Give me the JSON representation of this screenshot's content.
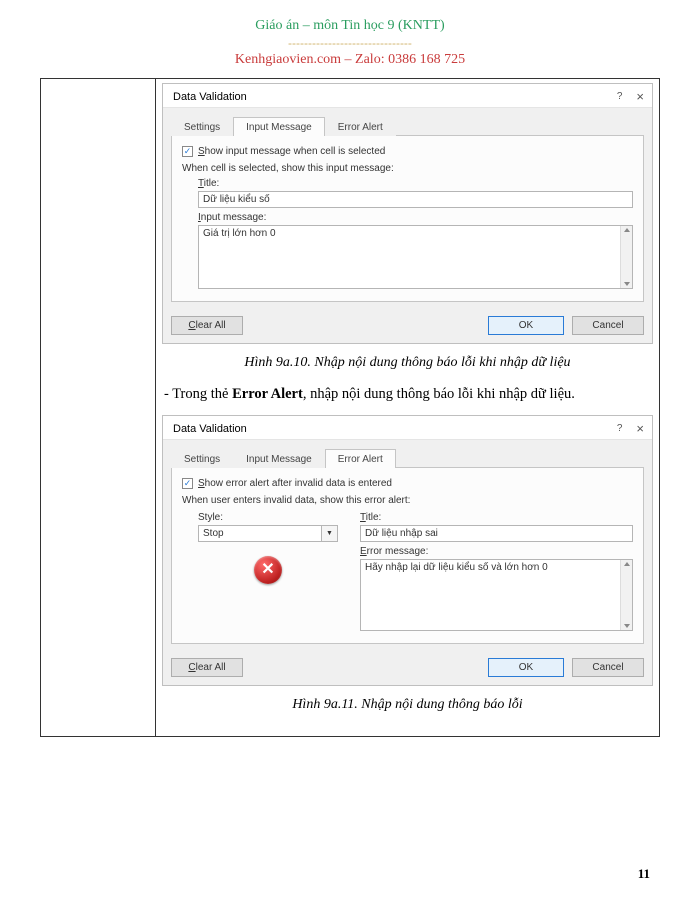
{
  "header": {
    "title": "Giáo án – môn Tin học 9 (KNTT)",
    "dashes": "-------------------------------",
    "subtitle": "Kenhgiaovien.com – Zalo: 0386 168 725"
  },
  "dialog1": {
    "title": "Data Validation",
    "help": "?",
    "close": "×",
    "tabs": {
      "settings": "Settings",
      "input_message": "Input Message",
      "error_alert": "Error Alert"
    },
    "checkbox_label_pre": "S",
    "checkbox_label_rest": "how input message when cell is selected",
    "subtext": "When cell is selected, show this input message:",
    "title_label_pre": "T",
    "title_label_rest": "itle:",
    "title_value": "Dữ liệu kiểu số",
    "msg_label_pre": "I",
    "msg_label_rest": "nput message:",
    "msg_value": "Giá trị lớn hơn 0",
    "clear_pre": "C",
    "clear_rest": "lear All",
    "ok": "OK",
    "cancel": "Cancel"
  },
  "caption1": "Hình 9a.10. Nhập nội dung thông báo lỗi khi nhập dữ liệu",
  "body_text_pre": "- Trong thẻ ",
  "body_text_strong": "Error Alert",
  "body_text_rest": ", nhập nội dung thông báo lỗi khi nhập dữ liệu.",
  "dialog2": {
    "title": "Data Validation",
    "help": "?",
    "close": "×",
    "tabs": {
      "settings": "Settings",
      "input_message": "Input Message",
      "error_alert": "Error Alert"
    },
    "checkbox_label_pre": "S",
    "checkbox_label_rest": "how error alert after invalid data is entered",
    "subtext": "When user enters invalid data, show this error alert:",
    "style_label": "Style:",
    "style_value": "Stop",
    "title_label_pre": "T",
    "title_label_rest": "itle:",
    "title_value": "Dữ liệu nhập sai",
    "err_label_pre": "E",
    "err_label_rest": "rror message:",
    "err_value": "Hãy nhập lại dữ liệu kiểu số và lớn hơn 0",
    "clear_pre": "C",
    "clear_rest": "lear All",
    "ok": "OK",
    "cancel": "Cancel"
  },
  "caption2": "Hình 9a.11. Nhập nội dung thông báo lỗi",
  "page_number": "11"
}
